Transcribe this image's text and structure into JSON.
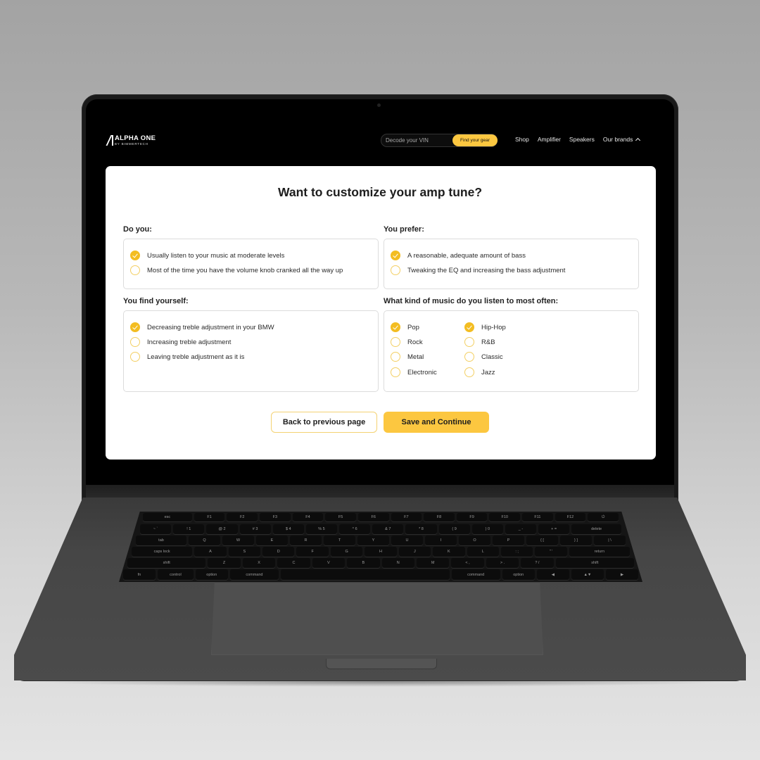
{
  "nav": {
    "logo": {
      "main": "ALPHA ONE",
      "sub": "BY BIMMERTECH"
    },
    "vin_placeholder": "Decode your VIN",
    "find_button": "Find your gear",
    "links": [
      "Shop",
      "Amplifier",
      "Speakers",
      "Our brands"
    ],
    "brands_icon": "chevron-up-icon"
  },
  "form": {
    "title": "Want to customize your amp tune?",
    "questions": [
      {
        "label": "Do you:",
        "options": [
          {
            "text": "Usually listen to your music at moderate levels",
            "selected": true
          },
          {
            "text": "Most of the time you have the volume knob cranked all the way up",
            "selected": false
          }
        ]
      },
      {
        "label": "You prefer:",
        "options": [
          {
            "text": "A reasonable, adequate amount of bass",
            "selected": true
          },
          {
            "text": "Tweaking the EQ and increasing the bass adjustment",
            "selected": false
          }
        ]
      },
      {
        "label": "You find yourself:",
        "options": [
          {
            "text": "Decreasing treble adjustment in your BMW",
            "selected": true
          },
          {
            "text": "Increasing treble adjustment",
            "selected": false
          },
          {
            "text": "Leaving treble adjustment as it is",
            "selected": false
          }
        ]
      },
      {
        "label": "What kind of music do you listen to most often:",
        "options": [
          {
            "text": "Pop",
            "selected": true
          },
          {
            "text": "Rock",
            "selected": false
          },
          {
            "text": "Metal",
            "selected": false
          },
          {
            "text": "Electronic",
            "selected": false
          },
          {
            "text": "Hip-Hop",
            "selected": true
          },
          {
            "text": "R&B",
            "selected": false
          },
          {
            "text": "Classic",
            "selected": false
          },
          {
            "text": "Jazz",
            "selected": false
          }
        ]
      }
    ],
    "back_button": "Back to previous page",
    "save_button": "Save and Continue"
  },
  "colors": {
    "accent": "#fcc740",
    "checked": "#f3bd22",
    "unchecked_border": "#f3cf63"
  },
  "keyboard": {
    "rows": [
      [
        "esc",
        "F1",
        "F2",
        "F3",
        "F4",
        "F5",
        "F6",
        "F7",
        "F8",
        "F9",
        "F10",
        "F11",
        "F12",
        "⏻"
      ],
      [
        "~ `",
        "! 1",
        "@ 2",
        "# 3",
        "$ 4",
        "% 5",
        "^ 6",
        "& 7",
        "* 8",
        "( 9",
        ") 0",
        "_ -",
        "+ =",
        "delete"
      ],
      [
        "tab",
        "Q",
        "W",
        "E",
        "R",
        "T",
        "Y",
        "U",
        "I",
        "O",
        "P",
        "{ [",
        "} ]",
        "| \\"
      ],
      [
        "caps lock",
        "A",
        "S",
        "D",
        "F",
        "G",
        "H",
        "J",
        "K",
        "L",
        ": ;",
        "\" '",
        "return"
      ],
      [
        "shift",
        "Z",
        "X",
        "C",
        "V",
        "B",
        "N",
        "M",
        "< ,",
        "> .",
        "? /",
        "shift"
      ],
      [
        "fn",
        "control",
        "option",
        "command",
        "",
        "command",
        "option",
        "◀",
        "▲▼",
        "▶"
      ]
    ]
  }
}
